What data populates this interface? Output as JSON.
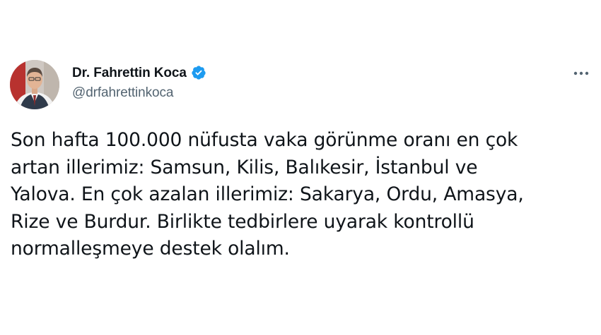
{
  "author": {
    "display_name": "Dr. Fahrettin Koca",
    "handle": "@drfahrettinkoca",
    "verified": true,
    "verified_color": "#1d9bf0"
  },
  "icons": {
    "verified": "verified-badge-icon",
    "more": "more-horizontal-icon"
  },
  "tweet": {
    "text": "Son hafta 100.000 nüfusta vaka görünme oranı en çok\nartan illerimiz: Samsun, Kilis, Balıkesir, İstanbul ve\nYalova. En çok azalan illerimiz: Sakarya, Ordu, Amasya,\nRize ve Burdur. Birlikte tedbirlere uyarak kontrollü\nnormalleşmeye destek olalım."
  },
  "colors": {
    "text_primary": "#0f1419",
    "text_secondary": "#536471",
    "background": "#ffffff"
  }
}
